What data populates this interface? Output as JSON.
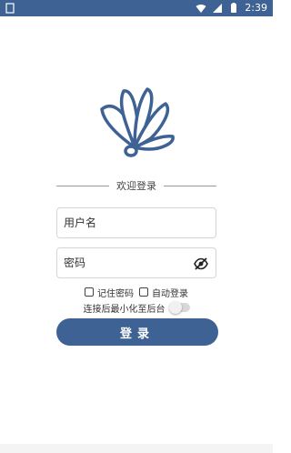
{
  "status_bar": {
    "time": "2:39",
    "icons": [
      "wifi-icon",
      "signal-icon",
      "battery-icon"
    ]
  },
  "brand": {
    "icon": "shell-logo",
    "color": "#3f6294"
  },
  "login": {
    "welcome": "欢迎登录",
    "username_placeholder": "用户名",
    "password_placeholder": "密码",
    "remember_password": "记住密码",
    "auto_login": "自动登录",
    "minimize_label": "连接后最小化至后台",
    "minimize_enabled": false,
    "remember_checked": false,
    "auto_login_checked": false,
    "submit_label": "登录"
  },
  "colors": {
    "accent": "#3f6294",
    "background": "#ffffff"
  }
}
